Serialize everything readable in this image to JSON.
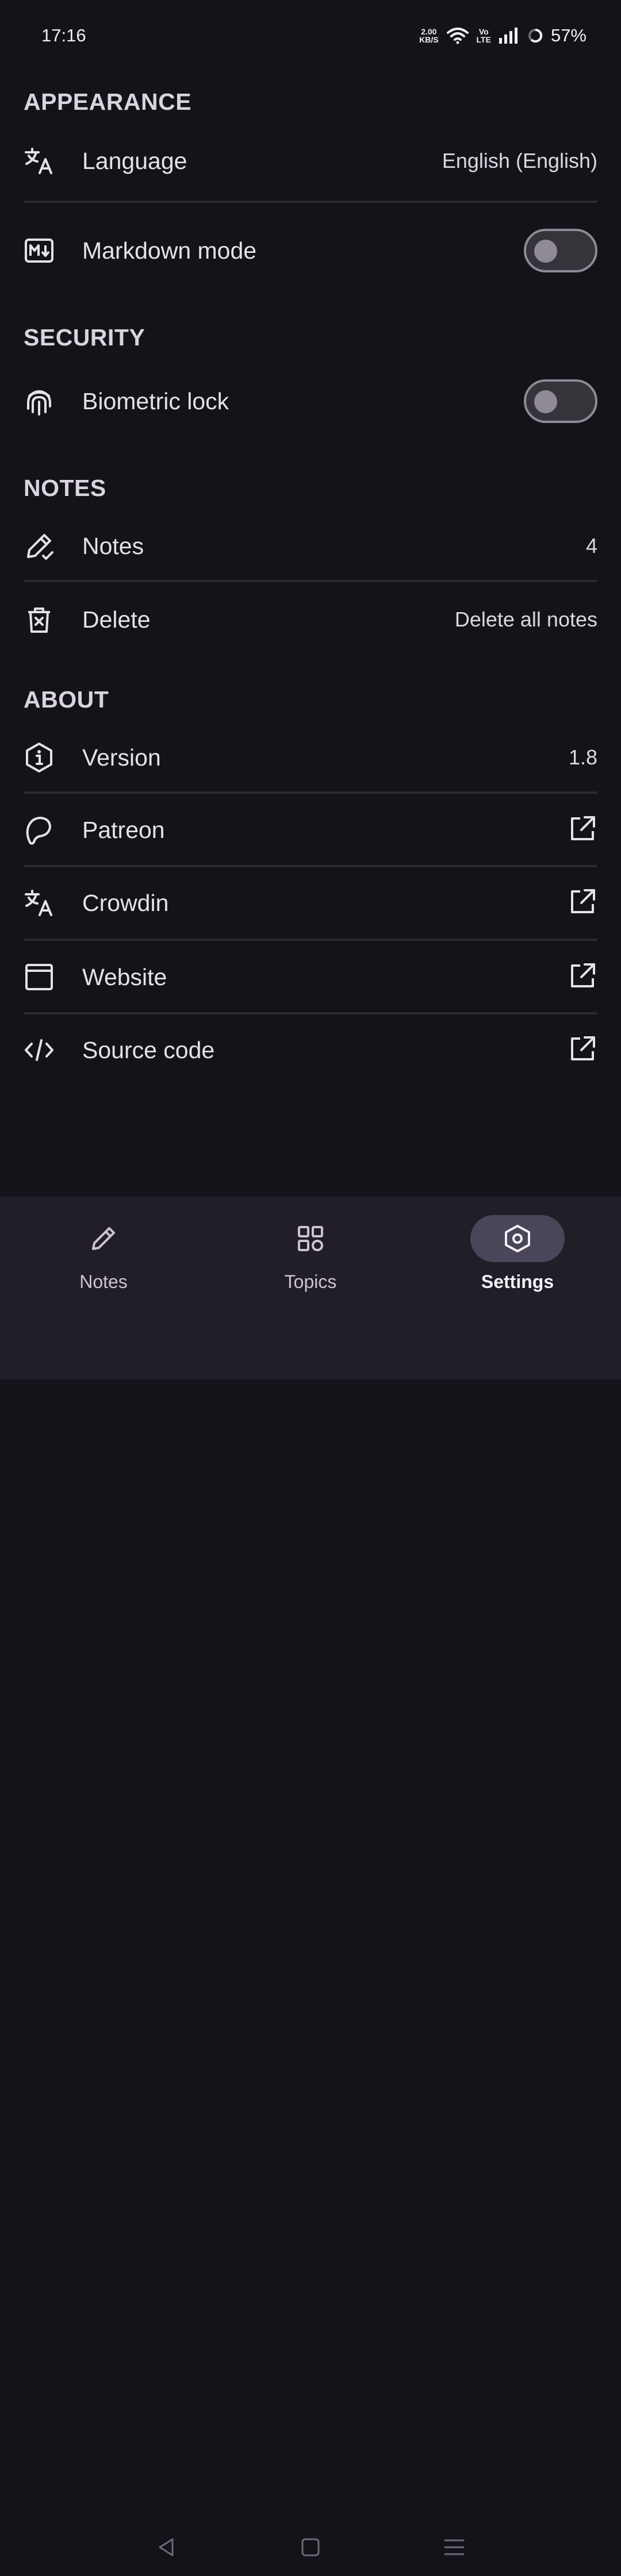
{
  "status_bar": {
    "time": "17:16",
    "net_speed_value": "2.00",
    "net_speed_unit": "KB/S",
    "volte_top": "Vo",
    "volte_bottom": "LTE",
    "battery": "57%"
  },
  "sections": {
    "appearance": "APPEARANCE",
    "security": "SECURITY",
    "notes": "NOTES",
    "about": "ABOUT"
  },
  "rows": {
    "language": {
      "label": "Language",
      "value": "English (English)"
    },
    "markdown": {
      "label": "Markdown mode",
      "enabled": false
    },
    "biometric": {
      "label": "Biometric lock",
      "enabled": false
    },
    "notes_count": {
      "label": "Notes",
      "value": "4"
    },
    "delete": {
      "label": "Delete",
      "value": "Delete all notes"
    },
    "version": {
      "label": "Version",
      "value": "1.8"
    },
    "patreon": {
      "label": "Patreon"
    },
    "crowdin": {
      "label": "Crowdin"
    },
    "website": {
      "label": "Website"
    },
    "source_code": {
      "label": "Source code"
    }
  },
  "bottom_nav": {
    "items": [
      {
        "label": "Notes",
        "icon": "pencil-icon",
        "active": false
      },
      {
        "label": "Topics",
        "icon": "grid-icon",
        "active": false
      },
      {
        "label": "Settings",
        "icon": "hexagon-settings-icon",
        "active": true
      }
    ]
  },
  "colors": {
    "background": "#15131a",
    "nav_background": "#211e28",
    "active_pill": "#4a4558",
    "switch_off": "#8f8a95"
  }
}
